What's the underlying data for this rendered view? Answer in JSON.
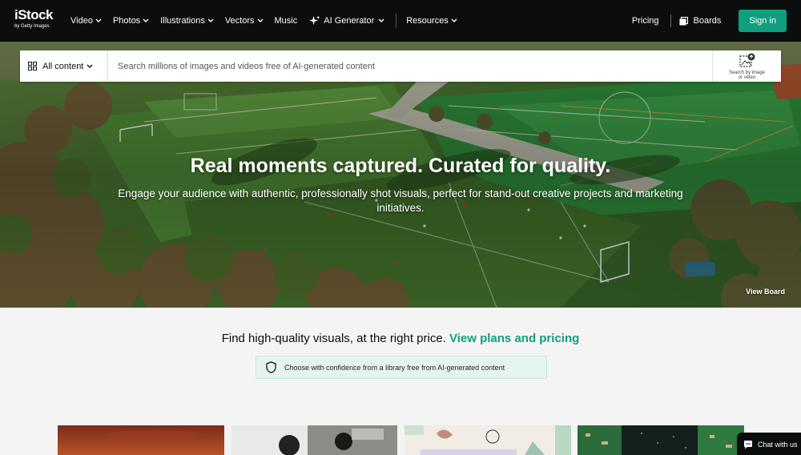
{
  "brand": {
    "name": "iStock",
    "tagline": "by Getty Images"
  },
  "nav": {
    "items": [
      {
        "label": "Video",
        "dropdown": true
      },
      {
        "label": "Photos",
        "dropdown": true
      },
      {
        "label": "Illustrations",
        "dropdown": true
      },
      {
        "label": "Vectors",
        "dropdown": true
      },
      {
        "label": "Music",
        "dropdown": false
      },
      {
        "label": "AI Generator",
        "dropdown": true,
        "icon": "sparkle-icon"
      },
      {
        "label": "Resources",
        "dropdown": true
      }
    ],
    "pricing": "Pricing",
    "boards": "Boards",
    "signin": "Sign in"
  },
  "search": {
    "scope": "All content",
    "placeholder": "Search millions of images and videos free of AI-generated content",
    "image_search_line1": "Search by image",
    "image_search_line2": "or video"
  },
  "hero": {
    "title": "Real moments captured. Curated for quality.",
    "subtitle": "Engage your audience with authentic, professionally shot visuals, perfect for stand-out creative projects and marketing initiatives.",
    "view_board": "View Board"
  },
  "promo": {
    "text": "Find high-quality visuals, at the right price.",
    "link": "View plans and pricing"
  },
  "badge": {
    "text": "Choose with confidence from a library free from AI-generated content"
  },
  "chat": {
    "label": "Chat with us"
  },
  "colors": {
    "accent": "#0f9f7e",
    "nav_bg": "#0c0d0d",
    "badge_bg": "#e6f4ef"
  }
}
